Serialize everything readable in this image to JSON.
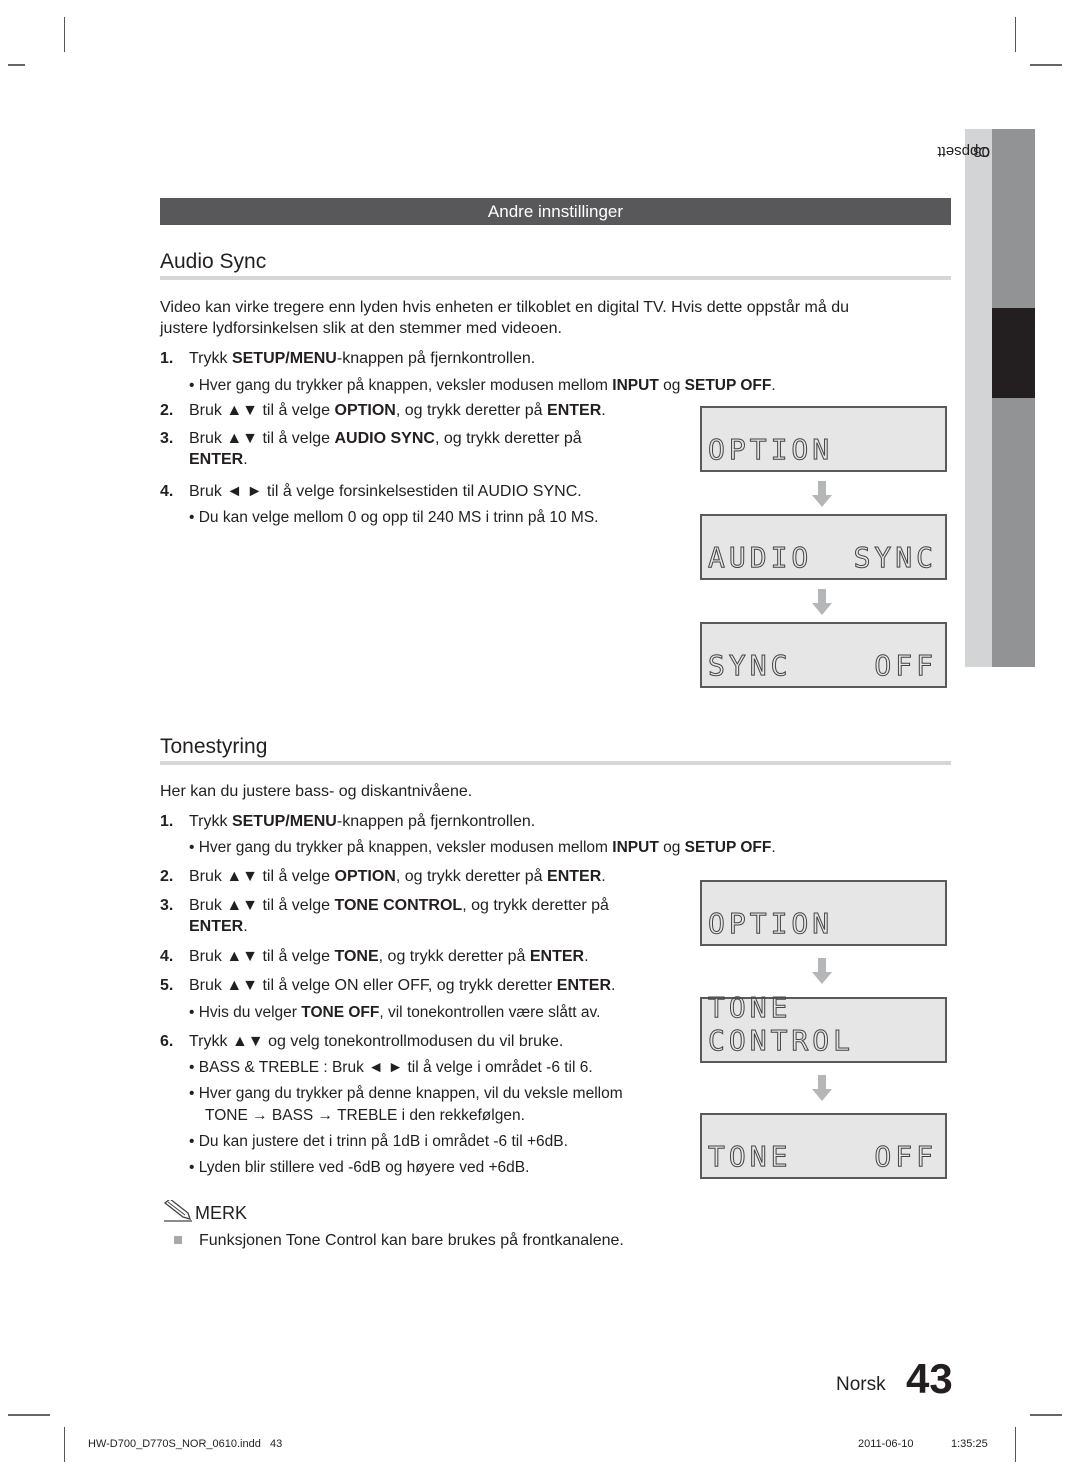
{
  "section_header": "Andre innstillinger",
  "side_tab": {
    "chapter": "03",
    "label": "Oppsett"
  },
  "audio_sync": {
    "title": "Audio Sync",
    "intro_line1": "Video kan virke tregere enn lyden hvis enheten er tilkoblet en digital TV. Hvis dette oppstår må du",
    "intro_line2": "justere lydforsinkelsen slik at den stemmer med videoen.",
    "steps": [
      {
        "num": "1.",
        "pre": "Trykk ",
        "b1": "SETUP/MENU",
        "post": "-knappen på fjernkontrollen."
      },
      {
        "num": "2.",
        "pre": "Bruk ▲▼ til å velge ",
        "b1": "OPTION",
        "mid": ", og trykk deretter på ",
        "b2": "ENTER",
        "post": "."
      },
      {
        "num": "3.",
        "pre": "Bruk ▲▼ til å velge ",
        "b1": "AUDIO SYNC",
        "mid": ", og trykk deretter på",
        "line2_b": "ENTER",
        "line2_post": "."
      },
      {
        "num": "4.",
        "text": "Bruk ◄ ► til å velge forsinkelsestiden til AUDIO SYNC."
      }
    ],
    "bullet1": {
      "pre": "• Hver gang du trykker på knappen, veksler modusen mellom ",
      "b1": "INPUT",
      "mid": " og ",
      "b2": "SETUP OFF",
      "post": "."
    },
    "bullet4": "• Du kan velge mellom 0 og opp til 240 MS i trinn på 10 MS.",
    "displays": [
      {
        "left": "OPTION",
        "right": ""
      },
      {
        "left": "AUDIO",
        "right": "SYNC"
      },
      {
        "left": "SYNC",
        "right": "OFF"
      }
    ]
  },
  "tone": {
    "title": "Tonestyring",
    "intro": "Her kan du justere bass- og diskantnivåene.",
    "steps": [
      {
        "num": "1.",
        "pre": "Trykk ",
        "b1": "SETUP/MENU",
        "post": "-knappen på fjernkontrollen."
      },
      {
        "num": "2.",
        "pre": "Bruk ▲▼ til å velge ",
        "b1": "OPTION",
        "mid": ", og trykk deretter på ",
        "b2": "ENTER",
        "post": "."
      },
      {
        "num": "3.",
        "pre": "Bruk ▲▼ til å velge ",
        "b1": "TONE CONTROL",
        "mid": ", og trykk deretter på",
        "line2_b": "ENTER",
        "line2_post": "."
      },
      {
        "num": "4.",
        "pre": "Bruk ▲▼ til å velge ",
        "b1": "TONE",
        "mid": ", og trykk deretter på ",
        "b2": "ENTER",
        "post": "."
      },
      {
        "num": "5.",
        "pre": "Bruk ▲▼ til å velge ON eller OFF, og trykk deretter ",
        "b1": "ENTER",
        "post": "."
      },
      {
        "num": "6.",
        "text": "Trykk ▲▼ og velg tonekontrollmodusen du vil bruke."
      }
    ],
    "bullet1": {
      "pre": "• Hver gang du trykker på knappen, veksler modusen mellom ",
      "b1": "INPUT",
      "mid": " og ",
      "b2": "SETUP OFF",
      "post": "."
    },
    "bullet5": {
      "pre": "• Hvis du velger ",
      "b1": "TONE OFF",
      "post": ", vil tonekontrollen være slått av."
    },
    "bullets6": [
      "• BASS & TREBLE : Bruk ◄ ► til å velge i området -6 til 6.",
      "• Hver gang du trykker på denne knappen, vil du veksle mellom",
      "TONE → BASS → TREBLE i den rekkefølgen.",
      "• Du kan justere det i trinn på 1dB i området -6 til +6dB.",
      "• Lyden blir stillere ved -6dB og høyere ved +6dB."
    ],
    "displays": [
      {
        "left": "OPTION",
        "right": ""
      },
      {
        "left": "TONE CONTROL",
        "right": ""
      },
      {
        "left": "TONE",
        "right": "OFF"
      }
    ]
  },
  "note": {
    "label": "MERK",
    "icon": "pencil-note-icon",
    "text": "Funksjonen Tone Control kan bare brukes på frontkanalene."
  },
  "footer": {
    "language": "Norsk",
    "page_number": "43",
    "file": "HW-D700_D770S_NOR_0610.indd   43",
    "date": "2011-06-10",
    "time": "1:35:25"
  }
}
